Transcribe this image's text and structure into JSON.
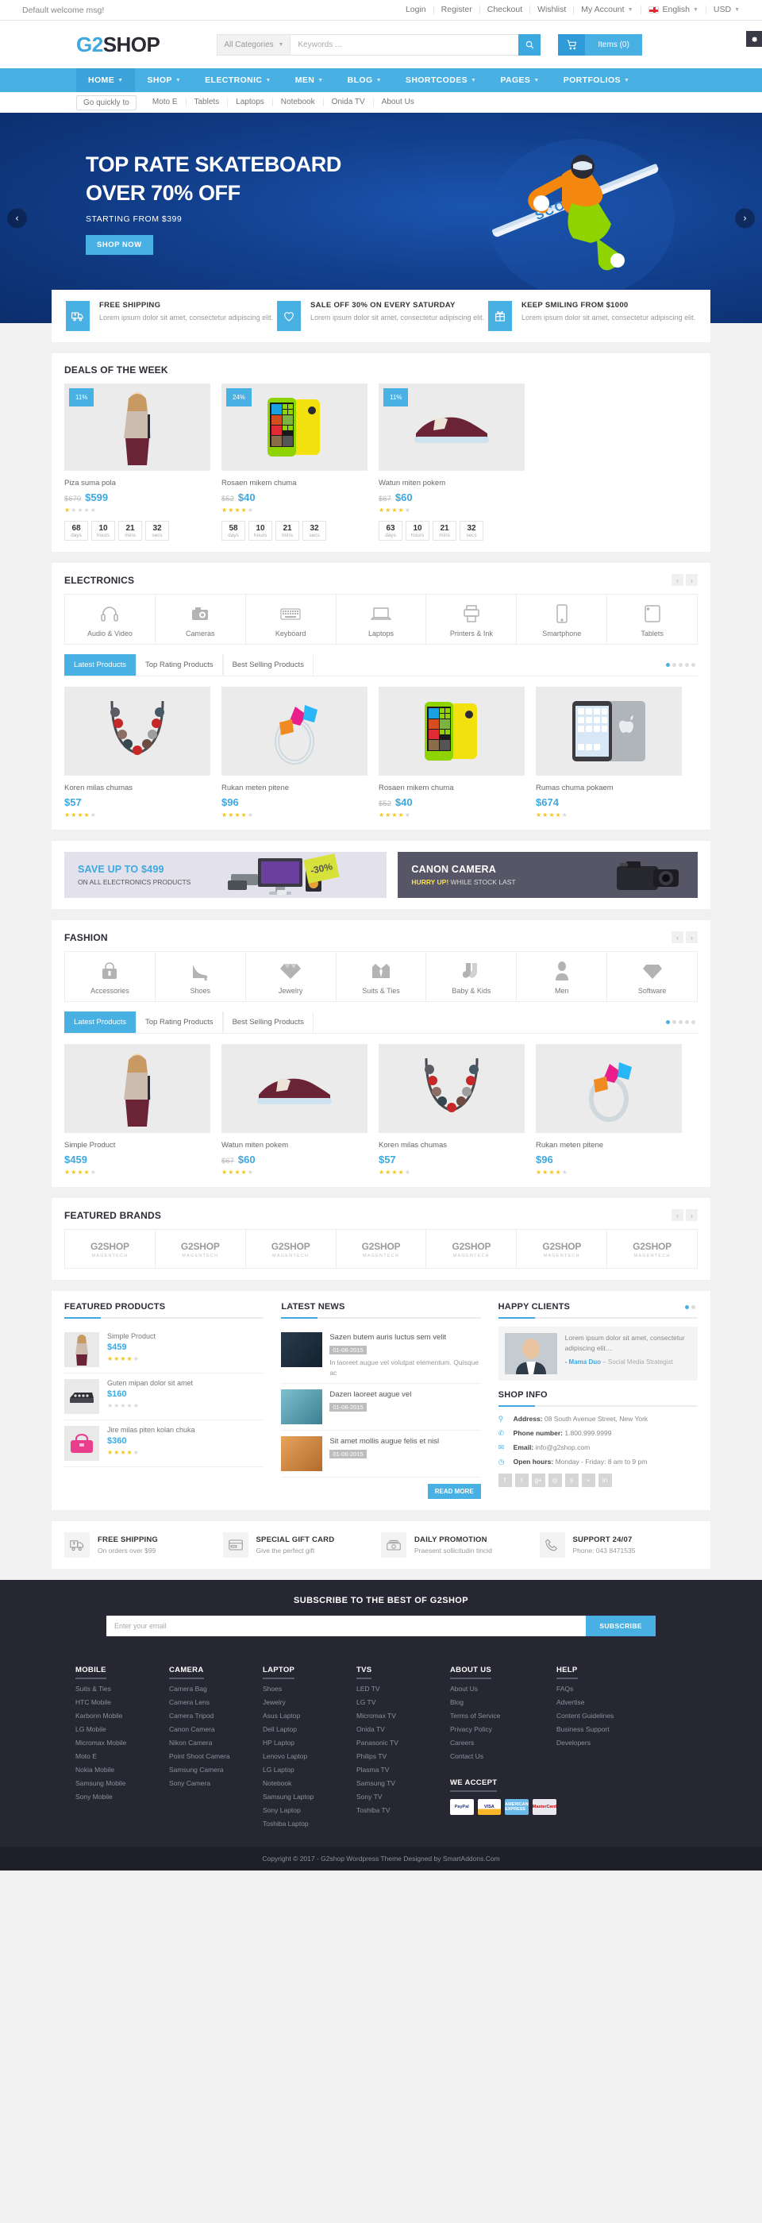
{
  "topbar": {
    "welcome": "Default welcome msg!",
    "links": [
      {
        "label": "Login",
        "caret": false
      },
      {
        "label": "Register",
        "caret": false
      },
      {
        "label": "Checkout",
        "caret": false
      },
      {
        "label": "Wishlist",
        "caret": false
      },
      {
        "label": "My Account",
        "caret": true
      }
    ],
    "language": "English",
    "currency": "USD"
  },
  "header": {
    "logo_g2": "G2",
    "logo_shop": "SHOP",
    "category_select": "All Categories",
    "search_placeholder": "Keywords ...",
    "search_icon": "search-icon",
    "cart_icon": "cart-icon",
    "cart_label": "Items (0)",
    "settings_icon": "gear-icon"
  },
  "mainnav": [
    {
      "label": "HOME",
      "caret": true,
      "active": true
    },
    {
      "label": "SHOP",
      "caret": true,
      "active": false
    },
    {
      "label": "ELECTRONIC",
      "caret": true,
      "active": false
    },
    {
      "label": "MEN",
      "caret": true,
      "active": false
    },
    {
      "label": "BLOG",
      "caret": true,
      "active": false
    },
    {
      "label": "SHORTCODES",
      "caret": true,
      "active": false
    },
    {
      "label": "PAGES",
      "caret": true,
      "active": false
    },
    {
      "label": "PORTFOLIOS",
      "caret": true,
      "active": false
    }
  ],
  "quicknav": {
    "badge": "Go quickly to",
    "links": [
      "Moto E",
      "Tablets",
      "Laptops",
      "Notebook",
      "Onida TV",
      "About Us"
    ]
  },
  "hero": {
    "title_line1": "TOP RATE SKATEBOARD",
    "title_line2": "OVER 70% OFF",
    "subtitle": "STARTING FROM $399",
    "button": "SHOP NOW",
    "prev_icon": "chevron-left-icon",
    "next_icon": "chevron-right-icon",
    "product_brand": "SCOTT"
  },
  "services_top": [
    {
      "icon": "shipping-truck-icon",
      "title": "FREE SHIPPING",
      "desc": "Lorem ipsum dolor sit amet, consectetur adipiscing elit."
    },
    {
      "icon": "heart-icon",
      "title": "SALE OFF 30% ON EVERY SATURDAY",
      "desc": "Lorem ipsum dolor sit amet, consectetur adipiscing elit."
    },
    {
      "icon": "gift-icon",
      "title": "KEEP SMILING FROM $1000",
      "desc": "Lorem ipsum dolor sit amet, consectetur adipiscing elit."
    }
  ],
  "deals": {
    "title": "DEALS OF THE WEEK",
    "items": [
      {
        "badge": "11%",
        "name": "Piza suma pola",
        "old_price": "$670",
        "price": "$599",
        "rating": 1.5,
        "countdown": [
          {
            "num": "68",
            "unit": "days"
          },
          {
            "num": "10",
            "unit": "hours"
          },
          {
            "num": "21",
            "unit": "mins"
          },
          {
            "num": "32",
            "unit": "secs"
          }
        ]
      },
      {
        "badge": "24%",
        "name": "Rosaen mikem chuma",
        "old_price": "$52",
        "price": "$40",
        "rating": 4,
        "countdown": [
          {
            "num": "58",
            "unit": "days"
          },
          {
            "num": "10",
            "unit": "hours"
          },
          {
            "num": "21",
            "unit": "mins"
          },
          {
            "num": "32",
            "unit": "secs"
          }
        ]
      },
      {
        "badge": "11%",
        "name": "Watun miten pokem",
        "old_price": "$67",
        "price": "$60",
        "rating": 4,
        "countdown": [
          {
            "num": "63",
            "unit": "days"
          },
          {
            "num": "10",
            "unit": "hours"
          },
          {
            "num": "21",
            "unit": "mins"
          },
          {
            "num": "32",
            "unit": "secs"
          }
        ]
      }
    ]
  },
  "electronics": {
    "title": "ELECTRONICS",
    "prev_icon": "chevron-left-icon",
    "next_icon": "chevron-right-icon",
    "categories": [
      {
        "icon": "headphones-icon",
        "label": "Audio & Video"
      },
      {
        "icon": "camera-icon",
        "label": "Cameras"
      },
      {
        "icon": "keyboard-icon",
        "label": "Keyboard"
      },
      {
        "icon": "laptop-icon",
        "label": "Laptops"
      },
      {
        "icon": "printer-icon",
        "label": "Printers & Ink"
      },
      {
        "icon": "smartphone-icon",
        "label": "Smartphone"
      },
      {
        "icon": "tablet-icon",
        "label": "Tablets"
      }
    ],
    "tabs": [
      {
        "label": "Latest Products",
        "active": true
      },
      {
        "label": "Top Rating Products",
        "active": false
      },
      {
        "label": "Best Selling Products",
        "active": false
      }
    ],
    "pagination_dots": 5,
    "active_dot": 0,
    "products": [
      {
        "name": "Koren milas chumas",
        "old_price": "",
        "price": "$57",
        "rating": 4,
        "image": "necklace"
      },
      {
        "name": "Rukan meten pitene",
        "old_price": "",
        "price": "$96",
        "rating": 4,
        "image": "ring"
      },
      {
        "name": "Rosaen mikem chuma",
        "old_price": "$52",
        "price": "$40",
        "rating": 4,
        "image": "phone"
      },
      {
        "name": "Rumas chuma pokaem",
        "old_price": "",
        "price": "$674",
        "rating": 4,
        "image": "tablet"
      }
    ]
  },
  "banners": {
    "left": {
      "title_pre": "SAVE UP TO ",
      "title_amount": "$499",
      "subtitle": "ON ALL ELECTRONICS PRODUCTS",
      "discount": "-30%"
    },
    "right": {
      "title": "CANON CAMERA",
      "highlight": "HURRY UP!",
      "rest": " WHILE STOCK LAST"
    }
  },
  "fashion": {
    "title": "FASHION",
    "prev_icon": "chevron-left-icon",
    "next_icon": "chevron-right-icon",
    "categories": [
      {
        "icon": "handbag-icon",
        "label": "Accessories"
      },
      {
        "icon": "high-heel-icon",
        "label": "Shoes"
      },
      {
        "icon": "diamond-icon",
        "label": "Jewelry"
      },
      {
        "icon": "suit-icon",
        "label": "Suits & Ties"
      },
      {
        "icon": "socks-icon",
        "label": "Baby & Kids"
      },
      {
        "icon": "person-icon",
        "label": "Men"
      },
      {
        "icon": "gem-icon",
        "label": "Software"
      }
    ],
    "tabs": [
      {
        "label": "Latest Products",
        "active": true
      },
      {
        "label": "Top Rating Products",
        "active": false
      },
      {
        "label": "Best Selling Products",
        "active": false
      }
    ],
    "pagination_dots": 5,
    "active_dot": 0,
    "products": [
      {
        "name": "Simple Product",
        "old_price": "",
        "price": "$459",
        "rating": 4,
        "image": "model"
      },
      {
        "name": "Watun miten pokem",
        "old_price": "$67",
        "price": "$60",
        "rating": 4,
        "image": "shoe"
      },
      {
        "name": "Koren milas chumas",
        "old_price": "",
        "price": "$57",
        "rating": 4,
        "image": "necklace"
      },
      {
        "name": "Rukan meten pitene",
        "old_price": "",
        "price": "$96",
        "rating": 4,
        "image": "ring"
      }
    ]
  },
  "brands": {
    "title": "FEATURED BRANDS",
    "prev_icon": "chevron-left-icon",
    "next_icon": "chevron-right-icon",
    "items": [
      {
        "name": "G2SHOP",
        "sub": "MAGENTECH"
      },
      {
        "name": "G2SHOP",
        "sub": "MAGENTECH"
      },
      {
        "name": "G2SHOP",
        "sub": "MAGENTECH"
      },
      {
        "name": "G2SHOP",
        "sub": "MAGENTECH"
      },
      {
        "name": "G2SHOP",
        "sub": "MAGENTECH"
      },
      {
        "name": "G2SHOP",
        "sub": "MAGENTECH"
      },
      {
        "name": "G2SHOP",
        "sub": "MAGENTECH"
      }
    ]
  },
  "featured_products": {
    "title": "FEATURED PRODUCTS",
    "items": [
      {
        "name": "Simple Product",
        "price": "$459",
        "rating": 4
      },
      {
        "name": "Guten mipan dolor sit amet",
        "price": "$160",
        "rating": 0
      },
      {
        "name": "Jire milas piten kolan chuka",
        "price": "$360",
        "rating": 4
      }
    ]
  },
  "latest_news": {
    "title": "LATEST NEWS",
    "items": [
      {
        "title": "Sazen butem auris luctus sem velit",
        "date": "01-06-2015",
        "excerpt": "In laoreet augue vel volutpat elementum. Quisque ac"
      },
      {
        "title": "Dazen laoreet augue vel",
        "date": "01-06-2015",
        "excerpt": ""
      },
      {
        "title": "Sit amet mollis augue felis et nisl",
        "date": "01-06-2015",
        "excerpt": ""
      }
    ],
    "read_more": "READ MORE"
  },
  "happy_clients": {
    "title": "HAPPY CLIENTS",
    "quote": "Lorem ipsum dolor sit amet, consectetur adipiscing elit....",
    "author": "- Mama Duo",
    "role": "– Social Media Strategist",
    "dots": 2,
    "active_dot": 0
  },
  "shop_info": {
    "title": "SHOP INFO",
    "rows": [
      {
        "icon": "map-pin-icon",
        "label": "Address:",
        "value": "08 South Avenue Street, New York"
      },
      {
        "icon": "phone-icon",
        "label": "Phone number:",
        "value": "1.800.999.9999"
      },
      {
        "icon": "envelope-icon",
        "label": "Email:",
        "value": "info@g2shop.com"
      },
      {
        "icon": "clock-icon",
        "label": "Open hours:",
        "value": "Monday - Friday: 8 am to 9 pm"
      }
    ],
    "socials": [
      "facebook-icon",
      "twitter-icon",
      "google-plus-icon",
      "pinterest-icon",
      "skype-icon",
      "flickr-icon",
      "linkedin-icon"
    ],
    "social_glyphs": [
      "f",
      "✉",
      "g+",
      "◎",
      "●",
      "■",
      "in"
    ]
  },
  "services_bottom": [
    {
      "icon": "delivery-truck-icon",
      "title": "FREE SHIPPING",
      "desc": "On orders over $99"
    },
    {
      "icon": "credit-card-icon",
      "title": "SPECIAL GIFT CARD",
      "desc": "Give the perfect gift"
    },
    {
      "icon": "money-icon",
      "title": "DAILY PROMOTION",
      "desc": "Praesent sollicitudin tincid"
    },
    {
      "icon": "telephone-icon",
      "title": "SUPPORT 24/07",
      "desc": "Phone: 043 8471535"
    }
  ],
  "newsletter": {
    "title": "SUBSCRIBE TO THE BEST OF G2SHOP",
    "placeholder": "Enter your email",
    "button": "SUBSCRIBE"
  },
  "footer_columns": [
    {
      "heading": "MOBILE",
      "links": [
        "Suits & Ties",
        "HTC Mobile",
        "Karbonn Mobile",
        "LG Mobile",
        "Micromax Mobile",
        "Moto E",
        "Nokia Mobile",
        "Samsung Mobile",
        "Sony Mobile"
      ]
    },
    {
      "heading": "CAMERA",
      "links": [
        "Camera Bag",
        "Camera Lens",
        "Camera Tripod",
        "Canon Camera",
        "Nikon Camera",
        "Point Shoot Camera",
        "Samsung Camera",
        "Sony Camera"
      ]
    },
    {
      "heading": "LAPTOP",
      "links": [
        "Shoes",
        "Jewelry",
        "Asus Laptop",
        "Dell Laptop",
        "HP Laptop",
        "Lenovo Laptop",
        "LG Laptop",
        "Notebook",
        "Samsung Laptop",
        "Sony Laptop",
        "Toshiba Laptop"
      ]
    },
    {
      "heading": "TVS",
      "links": [
        "LED TV",
        "LG TV",
        "Micromax TV",
        "Onida TV",
        "Panasonic TV",
        "Philips TV",
        "Plasma TV",
        "Samsung TV",
        "Sony TV",
        "Toshiba TV"
      ]
    },
    {
      "heading": "ABOUT US",
      "links": [
        "About Us",
        "Blog",
        "Terms of Service",
        "Privacy Policy",
        "Careers",
        "Contact Us"
      ]
    },
    {
      "heading": "HELP",
      "links": [
        "FAQs",
        "Advertise",
        "Content Guidelines",
        "Business Support",
        "Developers"
      ]
    }
  ],
  "we_accept": {
    "heading": "WE ACCEPT",
    "methods": [
      {
        "name": "PayPal",
        "icon": "paypal-icon"
      },
      {
        "name": "VISA",
        "icon": "visa-icon"
      },
      {
        "name": "AMERICAN EXPRESS",
        "icon": "amex-icon"
      },
      {
        "name": "MasterCard",
        "icon": "mastercard-icon"
      }
    ]
  },
  "copyright": "Copyright © 2017 - G2shop Wordpress Theme Designed by SmartAddons.Com",
  "colors": {
    "accent": "#49b0e4",
    "price": "#3ea8e0",
    "dark": "#272733",
    "star": "#f5c518",
    "hero_bg": "#123f8c"
  }
}
